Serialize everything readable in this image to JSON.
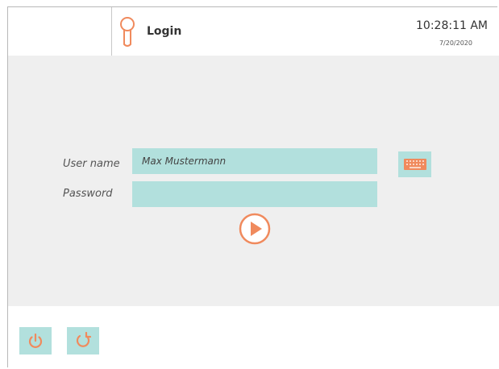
{
  "header": {
    "title": "Login",
    "icon": "key-icon",
    "time": "10:28:11 AM",
    "date": "7/20/2020"
  },
  "login_form": {
    "username_label": "User name",
    "username_value": "Max Mustermann",
    "password_label": "Password",
    "password_value": ""
  },
  "icons": {
    "keyboard": "keyboard-icon",
    "submit": "play-icon",
    "power": "power-icon",
    "restart": "restart-icon"
  },
  "colors": {
    "accent": "#f08a5d",
    "field_bg": "#b2e0dd",
    "panel_bg": "#efefef"
  }
}
